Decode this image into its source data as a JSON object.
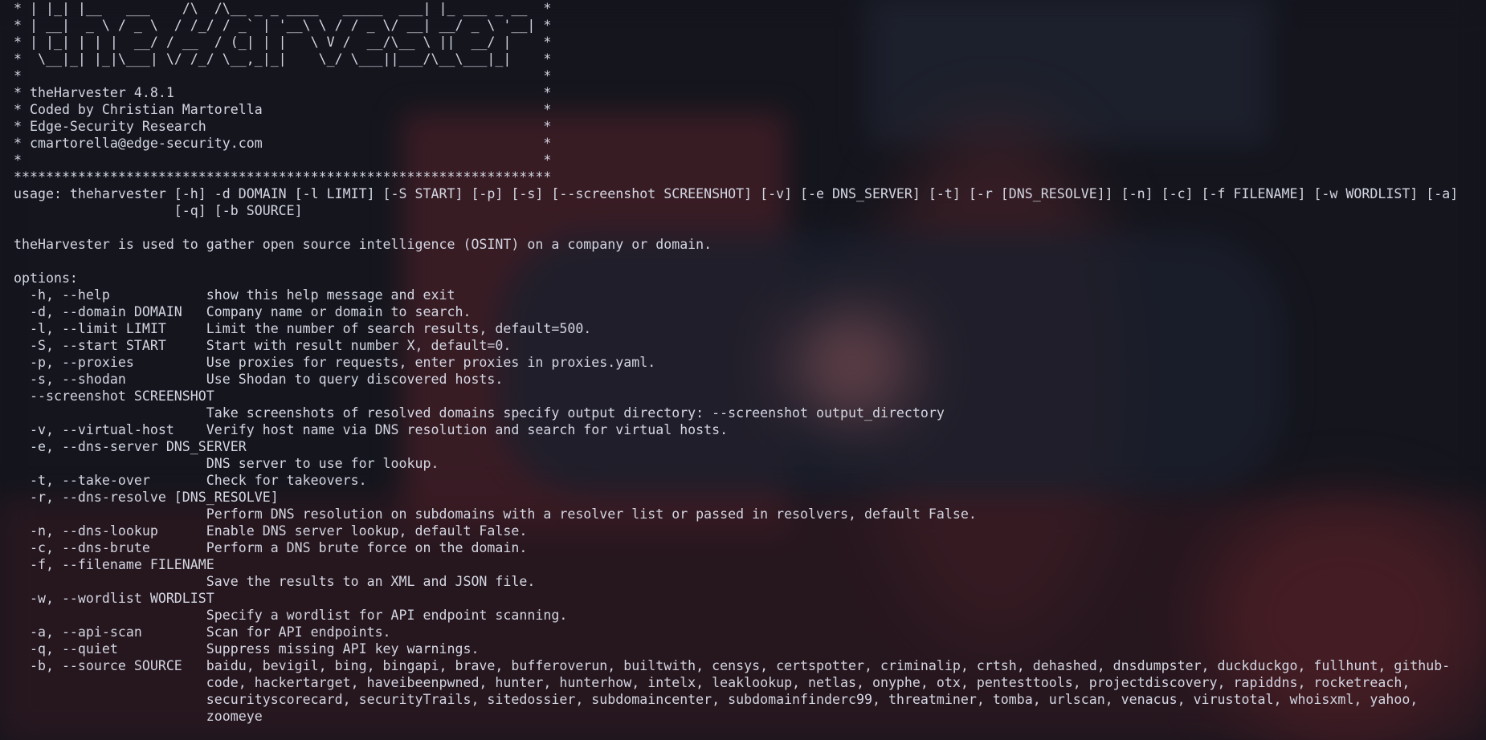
{
  "terminal": {
    "colors": {
      "background": "#14151d",
      "text": "#d3d6e2",
      "wallpaper_red": "#8a2a30"
    },
    "lines": [
      "* | |_| |__   ___    /\\  /\\__ _ _ ____   _____  ___| |_ ___ _ __  *",
      "* | __|  _ \\ / _ \\  / /_/ / _` | '__\\ \\ / / _ \\/ __| __/ _ \\ '__| *",
      "* | |_| | | |  __/ / __  / (_| | |   \\ V /  __/\\__ \\ ||  __/ |    *",
      "*  \\__|_| |_|\\___| \\/ /_/ \\__,_|_|    \\_/ \\___||___/\\__\\___|_|    *",
      "*                                                                 *",
      "* theHarvester 4.8.1                                              *",
      "* Coded by Christian Martorella                                   *",
      "* Edge-Security Research                                          *",
      "* cmartorella@edge-security.com                                   *",
      "*                                                                 *",
      "*******************************************************************",
      "usage: theharvester [-h] -d DOMAIN [-l LIMIT] [-S START] [-p] [-s] [--screenshot SCREENSHOT] [-v] [-e DNS_SERVER] [-t] [-r [DNS_RESOLVE]] [-n] [-c] [-f FILENAME] [-w WORDLIST] [-a]",
      "                    [-q] [-b SOURCE]",
      "",
      "theHarvester is used to gather open source intelligence (OSINT) on a company or domain.",
      "",
      "options:",
      "  -h, --help            show this help message and exit",
      "  -d, --domain DOMAIN   Company name or domain to search.",
      "  -l, --limit LIMIT     Limit the number of search results, default=500.",
      "  -S, --start START     Start with result number X, default=0.",
      "  -p, --proxies         Use proxies for requests, enter proxies in proxies.yaml.",
      "  -s, --shodan          Use Shodan to query discovered hosts.",
      "  --screenshot SCREENSHOT",
      "                        Take screenshots of resolved domains specify output directory: --screenshot output_directory",
      "  -v, --virtual-host    Verify host name via DNS resolution and search for virtual hosts.",
      "  -e, --dns-server DNS_SERVER",
      "                        DNS server to use for lookup.",
      "  -t, --take-over       Check for takeovers.",
      "  -r, --dns-resolve [DNS_RESOLVE]",
      "                        Perform DNS resolution on subdomains with a resolver list or passed in resolvers, default False.",
      "  -n, --dns-lookup      Enable DNS server lookup, default False.",
      "  -c, --dns-brute       Perform a DNS brute force on the domain.",
      "  -f, --filename FILENAME",
      "                        Save the results to an XML and JSON file.",
      "  -w, --wordlist WORDLIST",
      "                        Specify a wordlist for API endpoint scanning.",
      "  -a, --api-scan        Scan for API endpoints.",
      "  -q, --quiet           Suppress missing API key warnings.",
      "  -b, --source SOURCE   baidu, bevigil, bing, bingapi, brave, bufferoverun, builtwith, censys, certspotter, criminalip, crtsh, dehashed, dnsdumpster, duckduckgo, fullhunt, github-",
      "                        code, hackertarget, haveibeenpwned, hunter, hunterhow, intelx, leaklookup, netlas, onyphe, otx, pentesttools, projectdiscovery, rapiddns, rocketreach,",
      "                        securityscorecard, securityTrails, sitedossier, subdomaincenter, subdomainfinderc99, threatminer, tomba, urlscan, venacus, virustotal, whoisxml, yahoo,",
      "                        zoomeye"
    ]
  }
}
